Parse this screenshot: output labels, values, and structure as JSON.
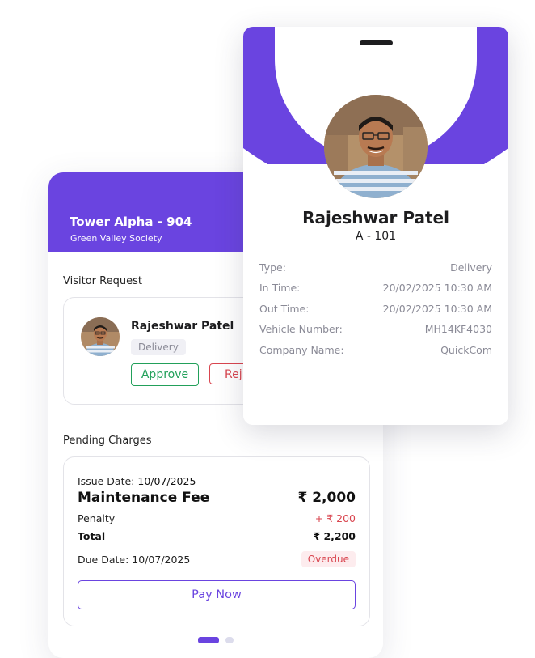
{
  "colors": {
    "accent": "#6a44e0",
    "success": "#22a05a",
    "danger": "#d9454f",
    "muted": "#8a8a96"
  },
  "header": {
    "title": "Tower Alpha - 904",
    "subtitle": "Green Valley Society"
  },
  "visitor_request": {
    "section_title": "Visitor Request",
    "name": "Rajeshwar Patel",
    "tag": "Delivery",
    "approve_label": "Approve",
    "reject_label": "Rej"
  },
  "pending_charges": {
    "section_title": "Pending Charges",
    "issue_label": "Issue Date:",
    "issue_date": "10/07/2025",
    "fee_name": "Maintenance Fee",
    "fee_amount": "₹ 2,000",
    "penalty_label": "Penalty",
    "penalty_amount": "+ ₹ 200",
    "total_label": "Total",
    "total_amount": "₹ 2,200",
    "due_label": "Due Date:",
    "due_date": "10/07/2025",
    "status_badge": "Overdue",
    "pay_label": "Pay Now"
  },
  "pager": {
    "active_index": 0,
    "count": 2
  },
  "id_card": {
    "name": "Rajeshwar Patel",
    "unit": "A - 101",
    "fields": [
      {
        "label": "Type:",
        "value": "Delivery"
      },
      {
        "label": "In Time:",
        "value": "20/02/2025 10:30 AM"
      },
      {
        "label": "Out Time:",
        "value": "20/02/2025 10:30 AM"
      },
      {
        "label": "Vehicle Number:",
        "value": "MH14KF4030"
      },
      {
        "label": "Company Name:",
        "value": "QuickCom"
      }
    ]
  }
}
